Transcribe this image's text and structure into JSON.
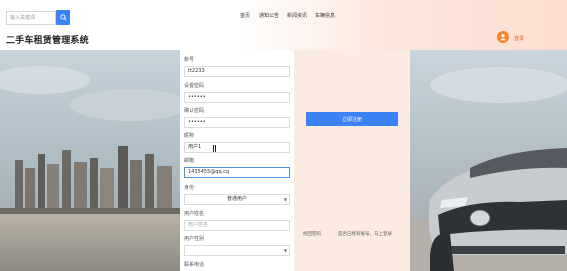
{
  "header": {
    "search_placeholder": "输入关键词",
    "nav": [
      "首页",
      "通知公告",
      "新闻资讯",
      "车辆信息"
    ],
    "site_title": "二手车租赁管理系统",
    "login_label": "登录"
  },
  "form": {
    "fields": [
      {
        "label": "账号",
        "value": "tt2233",
        "type": "text"
      },
      {
        "label": "设置密码",
        "value": "••••••",
        "type": "password"
      },
      {
        "label": "确认密码",
        "value": "••••••",
        "type": "password"
      },
      {
        "label": "昵称",
        "value": "用户1",
        "type": "text"
      },
      {
        "label": "邮箱",
        "value": "1435455@qq.cq",
        "type": "text"
      },
      {
        "label": "身份",
        "value": "普通用户",
        "type": "select"
      },
      {
        "label": "用户姓名",
        "placeholder": "用户姓名",
        "type": "text"
      },
      {
        "label": "用户性别",
        "value": "",
        "type": "select"
      },
      {
        "label": "联系电话",
        "type": "text"
      }
    ]
  },
  "panel": {
    "register_label": "立即注册",
    "forgot_label": "找回密码",
    "existing_label": "是否已经有账号，马上登录"
  },
  "colors": {
    "accent": "#3b82f6",
    "avatar": "#f6872f",
    "panel": "#fcebe1"
  },
  "icons": {
    "search": "search-icon",
    "avatar": "user-icon",
    "caret": "chevron-down-icon"
  }
}
